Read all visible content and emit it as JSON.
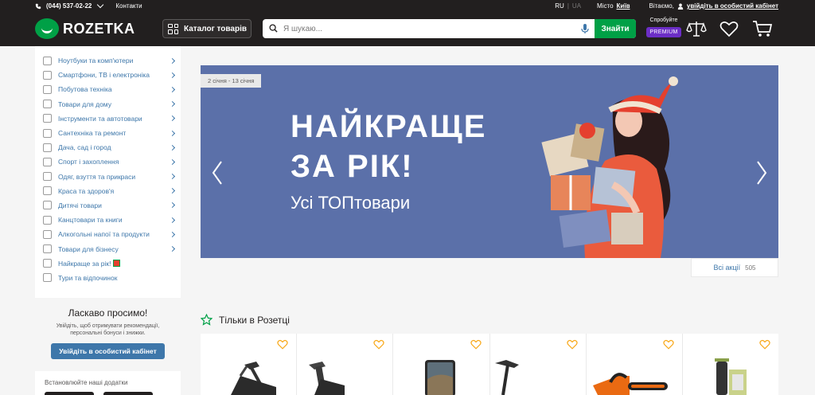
{
  "header": {
    "phone": "(044) 537-02-22",
    "contacts": "Контакти",
    "lang_ru": "RU",
    "lang_separator": "|",
    "lang_ua": "UA",
    "city_label": "Місто",
    "city_value": "Київ",
    "greeting": "Вітаємо,",
    "login_link": "увійдіть в особистий кабінет",
    "logo_text": "ROZETKA",
    "catalog_button": "Каталог товарів",
    "search_placeholder": "Я шукаю...",
    "search_button": "Знайти",
    "premium_try": "Спробуйте",
    "premium_badge": "PREMIUM"
  },
  "sidebar": {
    "items": [
      {
        "label": "Ноутбуки та комп'ютери",
        "arrow": true
      },
      {
        "label": "Смартфони, ТВ і електроніка",
        "arrow": true
      },
      {
        "label": "Побутова техніка",
        "arrow": true
      },
      {
        "label": "Товари для дому",
        "arrow": true
      },
      {
        "label": "Інструменти та автотовари",
        "arrow": true
      },
      {
        "label": "Сантехніка та ремонт",
        "arrow": true
      },
      {
        "label": "Дача, сад і город",
        "arrow": true
      },
      {
        "label": "Спорт і захоплення",
        "arrow": true
      },
      {
        "label": "Одяг, взуття та прикраси",
        "arrow": true
      },
      {
        "label": "Краса та здоров'я",
        "arrow": true
      },
      {
        "label": "Дитячі товари",
        "arrow": true
      },
      {
        "label": "Канцтовари та книги",
        "arrow": true
      },
      {
        "label": "Алкогольні напої та продукти",
        "arrow": true
      },
      {
        "label": "Товари для бізнесу",
        "arrow": true
      },
      {
        "label": "Найкраще за рік!",
        "arrow": false
      },
      {
        "label": "Тури та відпочинок",
        "arrow": false
      }
    ],
    "welcome_title": "Ласкаво просимо!",
    "welcome_text": "Увійдіть, щоб отримувати рекомендації, персональні бонуси і знижки.",
    "login_button": "Увійдіть в особистий кабінет",
    "apps_text": "Встановлюйте наші додатки"
  },
  "banner": {
    "date_range": "2 січня - 13 січня",
    "headline": "НАЙКРАЩЕ\nЗА РІК!",
    "subline": "Усі ТОПтовари",
    "all_promos": "Всі акції",
    "promo_count": "505"
  },
  "section": {
    "title": "Тільки в Розетці"
  },
  "products": [
    {
      "icon": "treadmill-icon"
    },
    {
      "icon": "treadmill-icon"
    },
    {
      "icon": "smartphone-icon"
    },
    {
      "icon": "treadmill-icon"
    },
    {
      "icon": "chainsaw-icon"
    },
    {
      "icon": "trimmer-icon"
    }
  ],
  "colors": {
    "header_bg": "#221f1f",
    "brand_green": "#00a046",
    "link_blue": "#3e77aa",
    "premium_purple": "#6c2ec6",
    "banner_bg": "#5b70a9",
    "heart_yellow": "#f8a818"
  }
}
